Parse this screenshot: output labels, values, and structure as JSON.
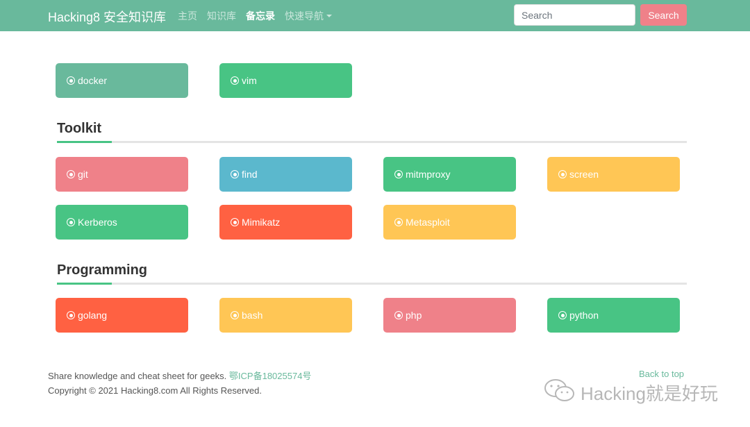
{
  "navbar": {
    "brand": "Hacking8 安全知识库",
    "links": [
      "主页",
      "知识库",
      "备忘录",
      "快速导航"
    ],
    "search_placeholder": "Search",
    "search_button": "Search",
    "color": "#69b99c"
  },
  "top_cards": [
    {
      "label": "docker",
      "color": "#69b99c"
    },
    {
      "label": "vim",
      "color": "#48c484"
    }
  ],
  "sections": [
    {
      "title": "Toolkit",
      "cards": [
        {
          "label": "git",
          "color": "#ef8189"
        },
        {
          "label": "find",
          "color": "#5bb8cd"
        },
        {
          "label": "mitmproxy",
          "color": "#48c484"
        },
        {
          "label": "screen",
          "color": "#ffc655"
        },
        {
          "label": "Kerberos",
          "color": "#48c484"
        },
        {
          "label": "Mimikatz",
          "color": "#ff6142"
        },
        {
          "label": "Metasploit",
          "color": "#ffc655"
        }
      ]
    },
    {
      "title": "Programming",
      "cards": [
        {
          "label": "golang",
          "color": "#ff6142"
        },
        {
          "label": "bash",
          "color": "#ffc655"
        },
        {
          "label": "php",
          "color": "#ef8189"
        },
        {
          "label": "python",
          "color": "#48c484"
        }
      ]
    }
  ],
  "footer": {
    "text": "Share knowledge and cheat sheet for geeks.",
    "icp": "鄂ICP备18025574号",
    "copyright": "Copyright © 2021 Hacking8.com All Rights Reserved.",
    "back_to_top": "Back to top"
  },
  "watermark": {
    "text": "Hacking就是好玩",
    "icon": "wechat-icon"
  }
}
